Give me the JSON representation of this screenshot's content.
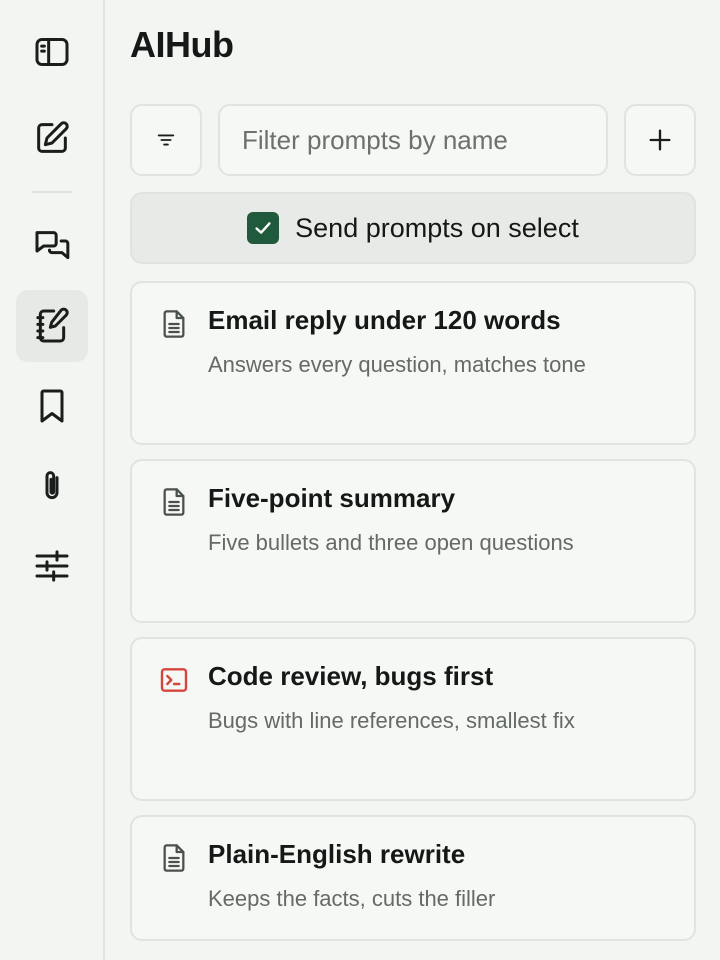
{
  "app": {
    "title": "AIHub"
  },
  "rail": {
    "items": [
      {
        "icon": "sidebar-panel-icon"
      },
      {
        "icon": "new-chat-icon"
      },
      {
        "icon": "conversations-icon"
      },
      {
        "icon": "prompt-notebook-icon",
        "active": true
      },
      {
        "icon": "bookmark-icon"
      },
      {
        "icon": "paperclip-icon"
      },
      {
        "icon": "sliders-icon"
      }
    ]
  },
  "toolbar": {
    "filter_icon": "filter-icon",
    "search_placeholder": "Filter prompts by name",
    "search_value": "",
    "add_icon": "plus-icon"
  },
  "toggle": {
    "label": "Send prompts on select",
    "checked": true
  },
  "prompts": [
    {
      "title": "Email reply under 120 words",
      "description": "Answers every question, matches tone",
      "icon": "document-icon"
    },
    {
      "title": "Five-point summary",
      "description": "Five bullets and three open questions",
      "icon": "document-icon"
    },
    {
      "title": "Code review, bugs first",
      "description": "Bugs with line references, smallest fix",
      "icon": "terminal-icon"
    },
    {
      "title": "Plain-English rewrite",
      "description": "Keeps the facts, cuts the filler",
      "icon": "document-icon"
    }
  ],
  "colors": {
    "accent": "#1f5a3c",
    "terminal_icon": "#d6453c"
  }
}
